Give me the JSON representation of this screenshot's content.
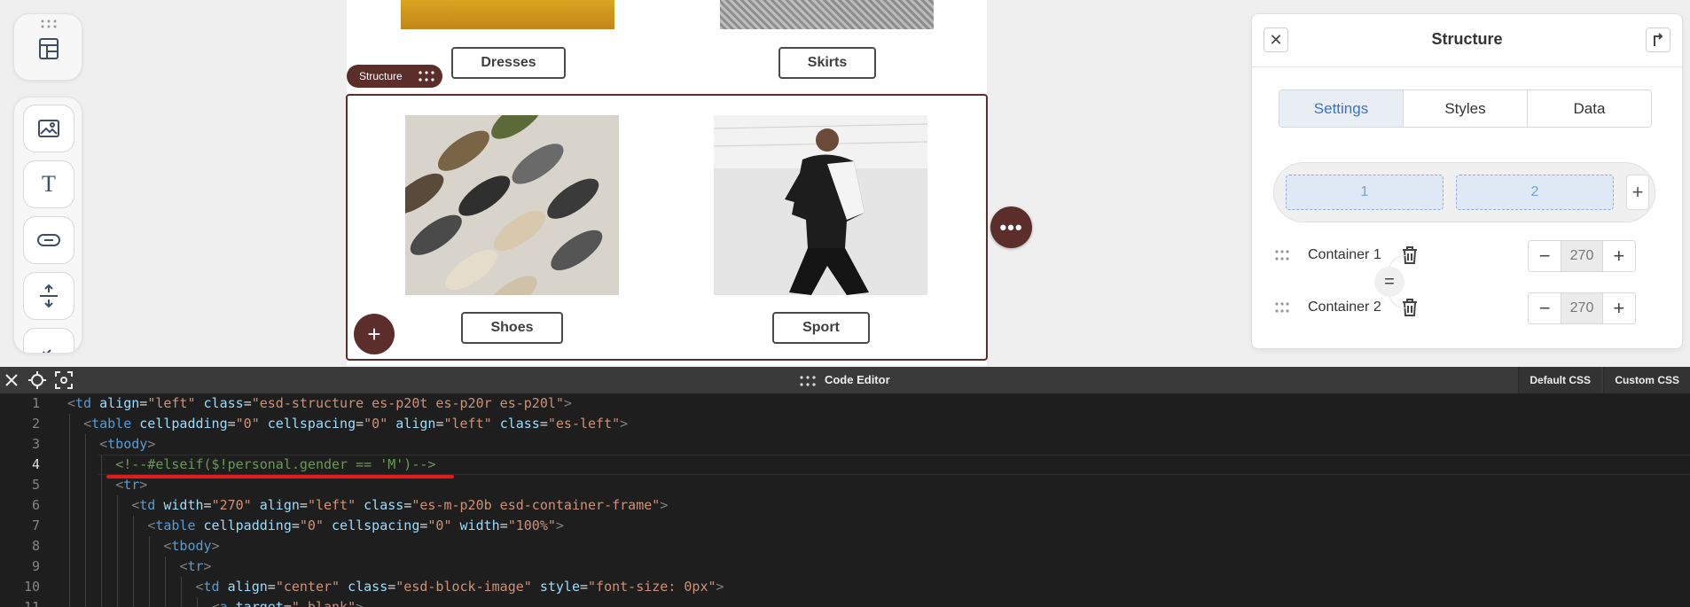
{
  "canvas": {
    "categories_top": [
      "Dresses",
      "Skirts"
    ],
    "categories_bottom": [
      "Shoes",
      "Sport"
    ],
    "structure_tag": "Structure",
    "add_label": "+",
    "more_label": "•••"
  },
  "panel": {
    "title": "Structure",
    "tabs": [
      "Settings",
      "Styles",
      "Data"
    ],
    "active_tab": "Settings",
    "columns": [
      "1",
      "2"
    ],
    "add_column": "+",
    "containers": [
      {
        "label": "Container 1",
        "width": "270"
      },
      {
        "label": "Container 2",
        "width": "270"
      }
    ],
    "link_symbol": "="
  },
  "editor": {
    "title": "Code Editor",
    "default_css": "Default CSS",
    "custom_css": "Custom CSS",
    "current_line": 4,
    "lines": [
      "<td align=\"left\" class=\"esd-structure es-p20t es-p20r es-p20l\">",
      "  <table cellpadding=\"0\" cellspacing=\"0\" align=\"left\" class=\"es-left\">",
      "    <tbody>",
      "      <!--#elseif($!personal.gender == 'M')-->",
      "      <tr>",
      "        <td width=\"270\" align=\"left\" class=\"es-m-p20b esd-container-frame\">",
      "          <table cellpadding=\"0\" cellspacing=\"0\" width=\"100%\">",
      "            <tbody>",
      "              <tr>",
      "                <td align=\"center\" class=\"esd-block-image\" style=\"font-size: 0px\">",
      "                  <a target=\"_blank\">"
    ]
  }
}
